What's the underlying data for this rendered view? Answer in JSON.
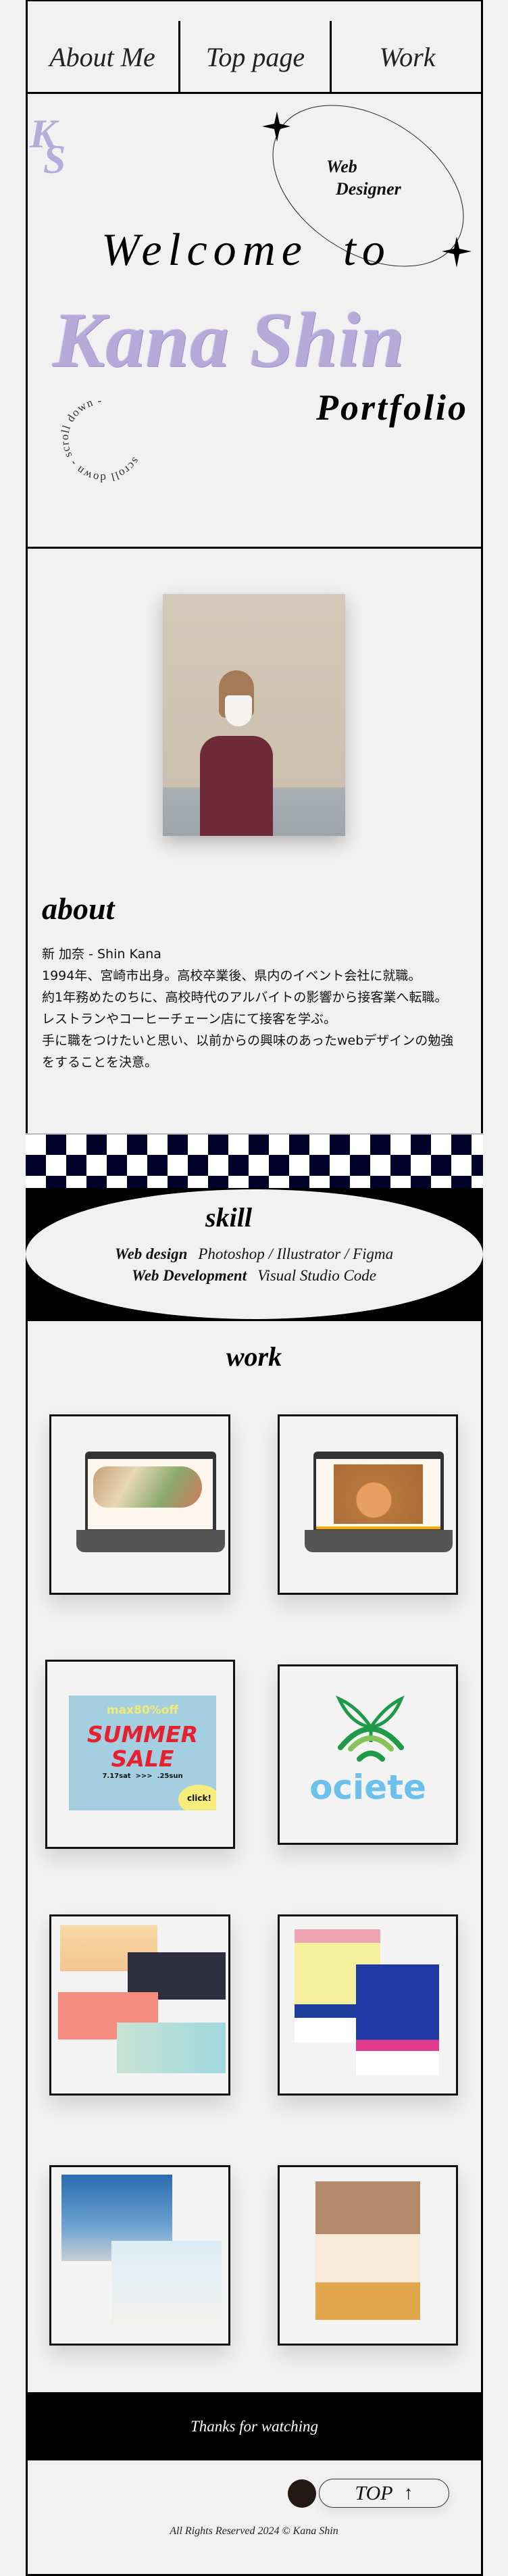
{
  "nav": {
    "items": [
      {
        "label": "About Me"
      },
      {
        "label": "Top page"
      },
      {
        "label": "Work"
      }
    ]
  },
  "hero": {
    "logo": "KS",
    "badge_line1": "Web",
    "badge_line2": "Designer",
    "welcome": "Welcome  to",
    "name": "Kana Shin",
    "portfolio": "Portfolio",
    "scroll_text": "scroll down - scroll down - ",
    "name_color": "#b5aad8"
  },
  "about": {
    "title": "about",
    "lines": [
      "新 加奈 - Shin Kana",
      "1994年、宮崎市出身。高校卒業後、県内のイベント会社に就職。",
      "約1年務めたのちに、高校時代のアルバイトの影響から接客業へ転職。",
      "レストランやコーヒーチェーン店にて接客を学ぶ。",
      "手に職をつけたいと思い、以前からの興味のあったwebデザインの勉強をすることを決意。"
    ]
  },
  "checker_color": "#000028",
  "skill": {
    "title": "skill",
    "rows": [
      {
        "category": "Web design",
        "tools": "Photoshop / Illustrator / Figma"
      },
      {
        "category": "Web Development",
        "tools": "Visual Studio Code"
      }
    ]
  },
  "work": {
    "title": "work",
    "banner": {
      "line1": "max80%off",
      "line2": "SUMMER",
      "line3": "SALE",
      "dates": "7.17sat  >>>  .25sun",
      "cta": "click!"
    },
    "logo_text": "ociete"
  },
  "footer": {
    "thanks": "Thanks for watching",
    "top_label": "TOP",
    "top_arrow": "↑",
    "copyright": "All Rights Reserved 2024 © Kana Shin"
  }
}
